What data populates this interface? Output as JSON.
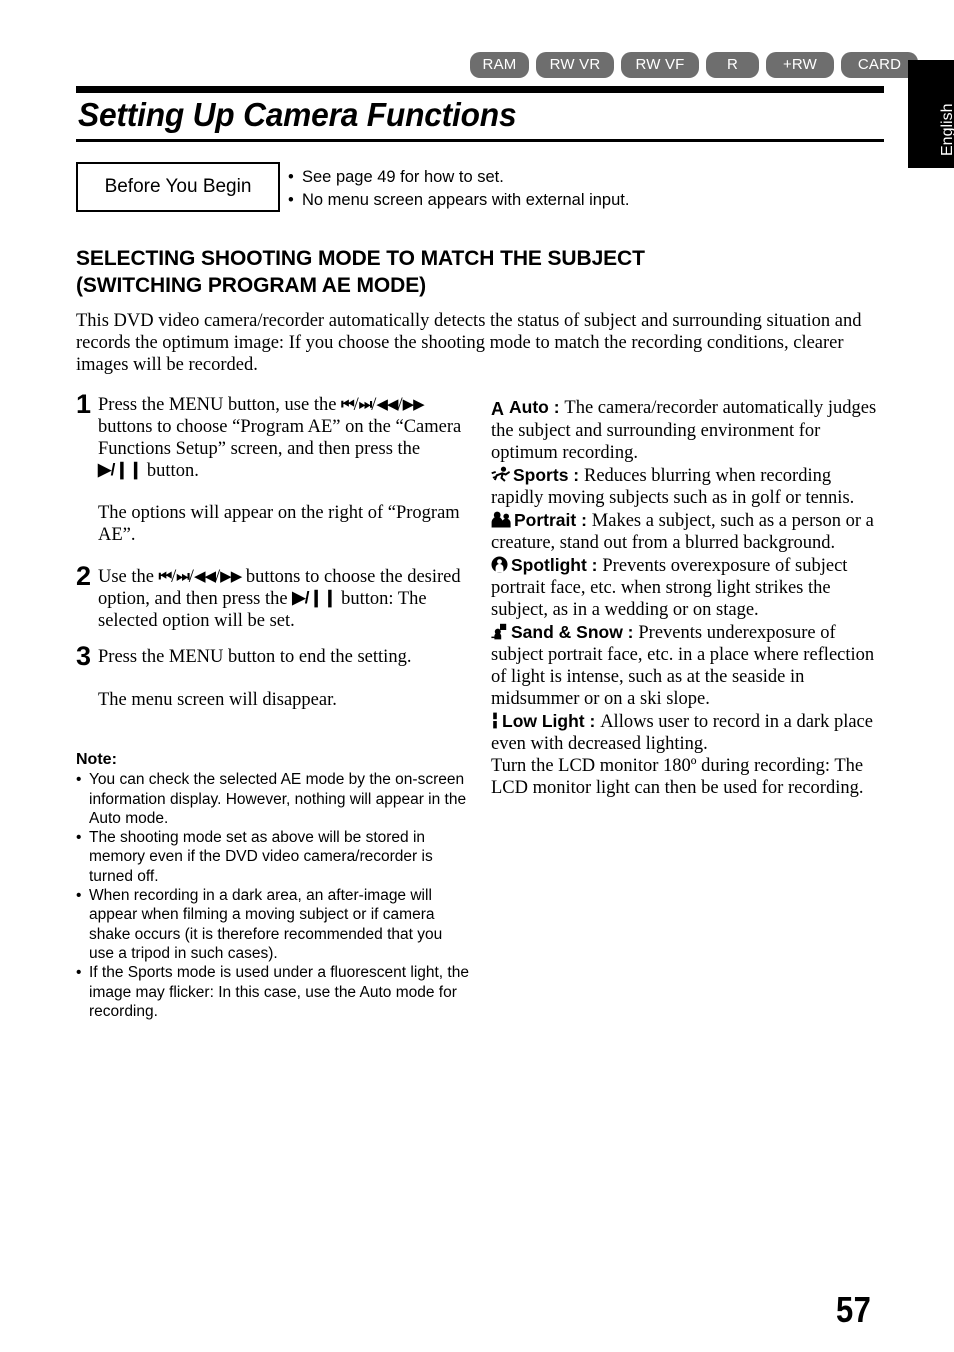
{
  "media_badges": [
    {
      "label": "RAM",
      "size": "w-ram"
    },
    {
      "label": "RW VR",
      "size": "w-rwvr"
    },
    {
      "label": "RW VF",
      "size": "w-rwvf"
    },
    {
      "label": "R",
      "size": "w-r"
    },
    {
      "label": "+RW",
      "size": "w-prw"
    },
    {
      "label": "CARD",
      "size": "w-card"
    }
  ],
  "language_tab": {
    "label": "English"
  },
  "header": {
    "title": "Setting Up Camera Functions"
  },
  "before_you_begin": {
    "box_label": "Before You Begin",
    "bullet": "•",
    "items": [
      "See page 49 for how to set.",
      "No menu screen appears with external input."
    ]
  },
  "section": {
    "heading_line1": "SELECTING SHOOTING MODE TO MATCH THE SUBJECT",
    "heading_line2": "(SWITCHING PROGRAM AE MODE)",
    "intro": "This DVD video camera/recorder automatically detects the status of subject and surrounding situation and records the optimum image: If you choose the shooting mode to match the recording conditions, clearer images will be recorded."
  },
  "steps": [
    {
      "number": "1",
      "text_a": "Press the MENU button, use the ",
      "glyph_prev": "⏮",
      "sep1": "/",
      "glyph_next": "⏭",
      "sep2": "/",
      "glyph_rew": "◀◀",
      "sep3": "/",
      "glyph_ff": "▶▶",
      "text_b": " buttons to choose “Program AE” on the “Camera Functions Setup” screen, and then press the ",
      "glyph_playpause": "▶/❙❙",
      "text_c": " button.",
      "sub": "The options will appear on the right of “Program AE”."
    },
    {
      "number": "2",
      "text_a": "Use the ",
      "glyph_prev": "⏮",
      "sep1": "/",
      "glyph_next": "⏭",
      "sep2": "/",
      "glyph_rew": "◀◀",
      "sep3": "/",
      "glyph_ff": "▶▶",
      "text_b": " buttons to choose the desired option, and then press the ",
      "glyph_playpause": "▶/❙❙",
      "text_c": " button: The selected option will be set.",
      "sub": ""
    },
    {
      "number": "3",
      "text_a": "Press the MENU button to end the setting.",
      "sub": "The menu screen will disappear."
    }
  ],
  "note": {
    "title": "Note",
    "title_colon": ":",
    "bullet": "•",
    "items": [
      "You can check the selected AE mode by the on-screen information display. However, nothing will appear in the Auto mode.",
      "The shooting mode set as above will be stored in memory even if the DVD video camera/recorder is turned off.",
      "When recording in a dark area, an after-image will appear when filming a moving subject or if camera shake occurs (it is therefore recommended that you use a tripod in such cases).",
      "If the Sports mode is used under a fluorescent light, the image may flicker: In this case, use the Auto mode for recording."
    ]
  },
  "modes": [
    {
      "icon": "letter-a-icon",
      "icon_char": "A",
      "name": "Auto",
      "colon": " : ",
      "description": "The camera/recorder automatically judges the subject and surrounding environment for optimum recording."
    },
    {
      "icon": "running-person-icon",
      "name": "Sports",
      "colon": " : ",
      "description": "Reduces blurring when recording rapidly moving subjects such as in golf or tennis."
    },
    {
      "icon": "two-people-icon",
      "name": "Portrait",
      "colon": " : ",
      "description": "Makes a subject, such as a person or a creature, stand out from a blurred background."
    },
    {
      "icon": "spotlight-person-icon",
      "name": "Spotlight",
      "colon": " : ",
      "description": "Prevents overexposure of subject portrait face, etc. when strong light strikes the subject, as in a wedding or on stage."
    },
    {
      "icon": "sand-snow-icon",
      "name": "Sand & Snow",
      "colon": " : ",
      "description": "Prevents underexposure of subject portrait face, etc. in a place where reflection of light is intense, such as at the seaside in midsummer or on a ski slope."
    },
    {
      "icon": "low-light-icon",
      "name": "Low Light",
      "colon": " : ",
      "description": "Allows user to record in a dark place even with decreased lighting."
    }
  ],
  "closing_note": "Turn the LCD monitor 180º during recording: The LCD monitor light can then be used for recording.",
  "page_number": "57",
  "colors": {
    "badge_background": "#6e6e6e",
    "badge_text": "#ffffff",
    "rule": "#000000",
    "tab_background": "#000000"
  }
}
